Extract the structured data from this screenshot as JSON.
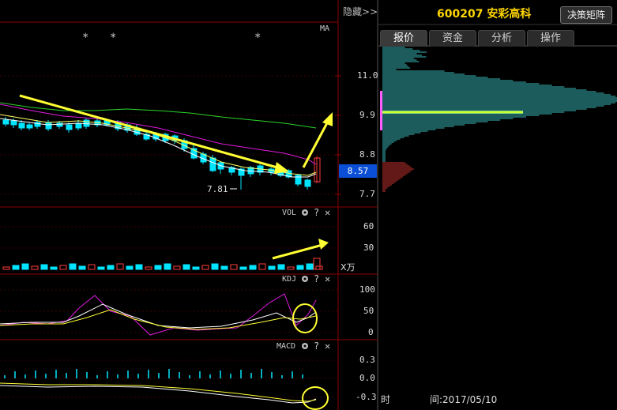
{
  "header": {
    "hide_label": "隐藏",
    "hide_chevron": ">>",
    "stock_code": "600207",
    "stock_name": "安彩高科",
    "decision_button": "决策矩阵"
  },
  "tabs": [
    {
      "label": "报价",
      "active": true
    },
    {
      "label": "资金",
      "active": false
    },
    {
      "label": "分析",
      "active": false
    },
    {
      "label": "操作",
      "active": false
    }
  ],
  "main_chart": {
    "ma_label": "MA",
    "star_marker": "*",
    "price_axis": [
      "11.0",
      "9.9",
      "8.8",
      "7.7"
    ],
    "current_price": "8.57",
    "low_marker": "7.81"
  },
  "volume_panel": {
    "label": "VOL",
    "axis": [
      "60",
      "30"
    ],
    "unit": "X万"
  },
  "kdj_panel": {
    "label": "KDJ",
    "axis": [
      "100",
      "50",
      "0"
    ]
  },
  "macd_panel": {
    "label": "MACD",
    "axis": [
      "0.3",
      "0.0",
      "-0.3"
    ]
  },
  "info": {
    "time_label": "时",
    "time_value": "间:2017/05/10"
  },
  "colors": {
    "up": "#ff3c3c",
    "down": "#00e5ff",
    "ma_green": "#2bd42b",
    "ma_magenta": "#e01be0",
    "ma_yellow": "#ffff00",
    "current_price_bg": "#0a4fd6",
    "code_yellow": "#ffd700"
  }
}
